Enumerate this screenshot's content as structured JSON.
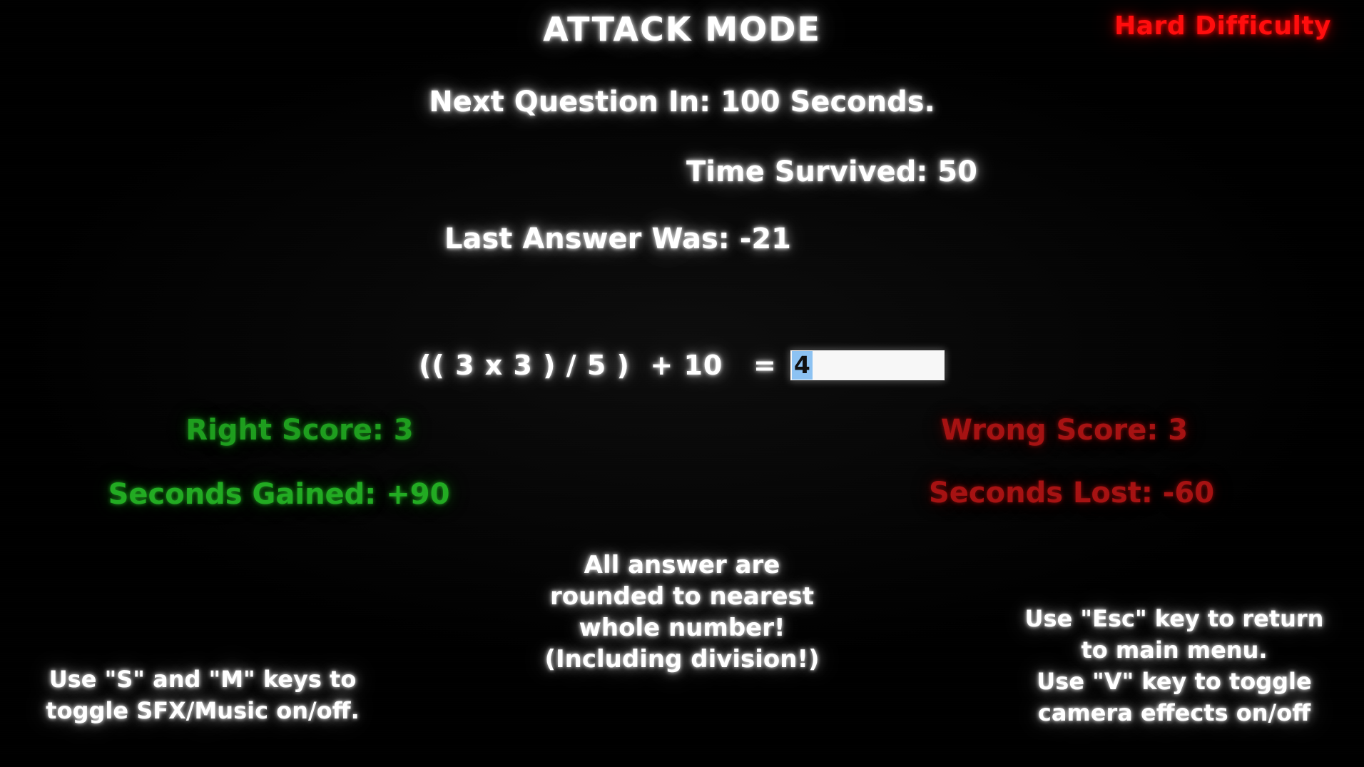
{
  "header": {
    "title": "ATTACK MODE",
    "difficulty": "Hard Difficulty"
  },
  "status": {
    "next_question": "Next Question In: 100 Seconds.",
    "next_question_seconds": 100,
    "time_survived": "Time Survived: 50",
    "time_survived_value": 50,
    "last_answer": "Last Answer Was: -21",
    "last_answer_value": -21
  },
  "question": {
    "equation": "(( 3 x 3 ) / 5 )  + 10   =",
    "input_value": "4",
    "input_placeholder": ""
  },
  "scores": {
    "right_score": "Right Score: 3",
    "right_score_value": 3,
    "wrong_score": "Wrong Score: 3",
    "wrong_score_value": 3,
    "seconds_gained": "Seconds Gained: +90",
    "seconds_gained_value": 90,
    "seconds_lost": "Seconds Lost: -60",
    "seconds_lost_value": -60
  },
  "notes": {
    "rounding": {
      "line1": "All answer are",
      "line2": "rounded to nearest",
      "line3": "whole number!",
      "line4": "(Including division!)"
    },
    "audio_hint": {
      "line1": "Use \"S\" and \"M\" keys to",
      "line2": "toggle SFX/Music on/off."
    },
    "keys_hint": {
      "line1": "Use \"Esc\" key to return",
      "line2": "to main menu.",
      "line3": "Use \"V\" key to toggle",
      "line4": "camera effects on/off"
    }
  },
  "colors": {
    "background": "#000000",
    "text": "#ffffff",
    "difficulty_red": "#ff0d0d",
    "negative_red": "#a61212",
    "positive_green": "#1e9e1e",
    "input_background": "#f7f7f7",
    "input_selection": "#8cc2f2"
  }
}
